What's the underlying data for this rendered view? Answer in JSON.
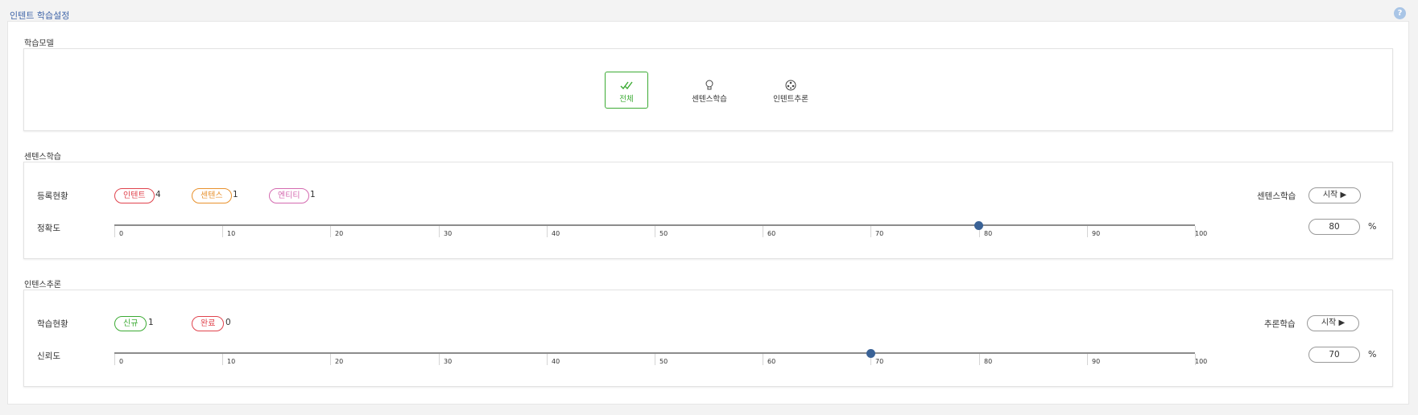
{
  "page_title": "인텐트 학습설정",
  "help_icon": "?",
  "model_section": {
    "label": "학습모델",
    "options": [
      {
        "label": "전체",
        "icon": "double-check-icon",
        "active": true
      },
      {
        "label": "센텐스학습",
        "icon": "lightbulb-icon",
        "active": false
      },
      {
        "label": "인텐트추론",
        "icon": "film-reel-icon",
        "active": false
      }
    ]
  },
  "sentence_section": {
    "label": "센텐스학습",
    "status_label": "등록현황",
    "badges": [
      {
        "label": "인텐트",
        "count": "4",
        "color": "#e0434d"
      },
      {
        "label": "센텐스",
        "count": "1",
        "color": "#e8912d"
      },
      {
        "label": "엔티티",
        "count": "1",
        "color": "#d46ab0"
      }
    ],
    "action_label": "센텐스학습",
    "start_button": "시작 ▶",
    "slider_label": "정확도",
    "slider_value": 80,
    "input_value": "80",
    "unit": "%",
    "ticks": [
      "0",
      "10",
      "20",
      "30",
      "40",
      "50",
      "60",
      "70",
      "80",
      "90",
      "100"
    ]
  },
  "intent_section": {
    "label": "인텐스추론",
    "status_label": "학습현황",
    "badges": [
      {
        "label": "신규",
        "count": "1",
        "color": "#3cab34"
      },
      {
        "label": "완료",
        "count": "0",
        "color": "#e0434d"
      }
    ],
    "action_label": "추론학습",
    "start_button": "시작 ▶",
    "slider_label": "신뢰도",
    "slider_value": 70,
    "input_value": "70",
    "unit": "%",
    "ticks": [
      "0",
      "10",
      "20",
      "30",
      "40",
      "50",
      "60",
      "70",
      "80",
      "90",
      "100"
    ]
  },
  "colors": {
    "accent_blue": "#3f65a8",
    "active_green": "#3cab34",
    "thumb": "#3a6296"
  }
}
